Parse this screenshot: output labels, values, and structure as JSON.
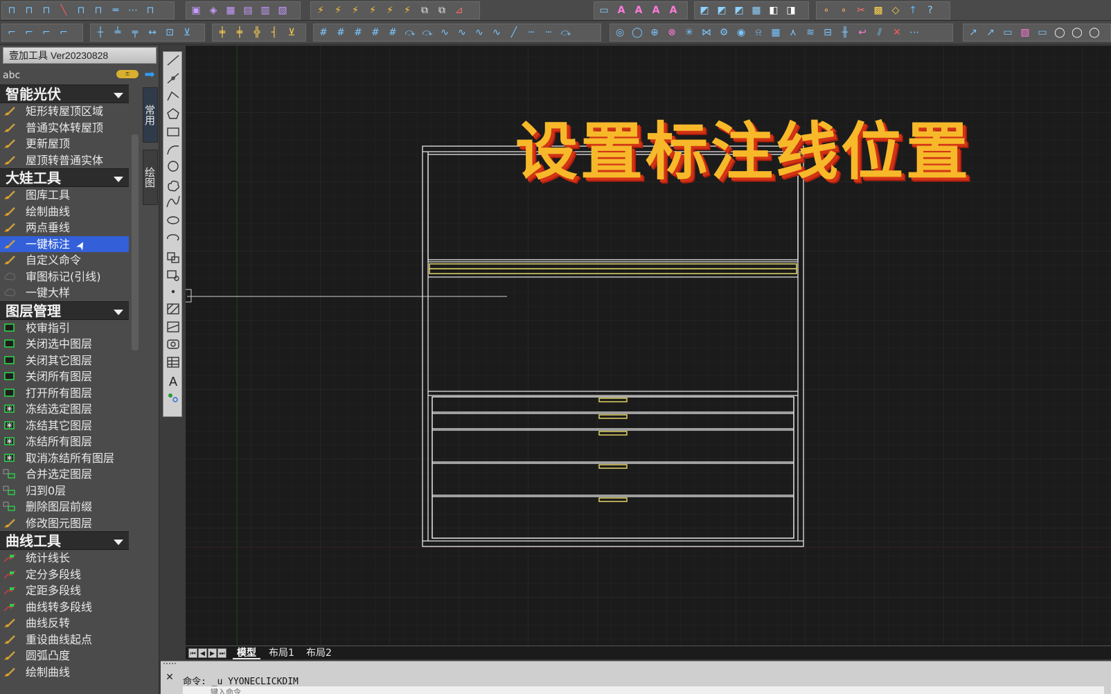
{
  "panel": {
    "title": "壹加工具 Ver20230828",
    "search_text": "abc",
    "side_tabs": {
      "common": "常用",
      "draw": "绘图"
    },
    "sections": [
      {
        "title": "智能光伏",
        "items": [
          {
            "label": "矩形转屋顶区域",
            "icon": "brush-icon"
          },
          {
            "label": "普通实体转屋顶",
            "icon": "brush-icon"
          },
          {
            "label": "更新屋顶",
            "icon": "brush-icon"
          },
          {
            "label": "屋顶转普通实体",
            "icon": "brush-icon"
          }
        ]
      },
      {
        "title": "大娃工具",
        "items": [
          {
            "label": "图库工具",
            "icon": "brush-icon"
          },
          {
            "label": "绘制曲线",
            "icon": "brush-icon"
          },
          {
            "label": "两点垂线",
            "icon": "brush-icon"
          },
          {
            "label": "一键标注",
            "icon": "brush-icon",
            "active": true
          },
          {
            "label": "自定义命令",
            "icon": "brush-icon"
          },
          {
            "label": "审图标记(引线)",
            "icon": "cloud-icon"
          },
          {
            "label": "一键大样",
            "icon": "cloud-icon"
          }
        ]
      },
      {
        "title": "图层管理",
        "items": [
          {
            "label": "校审指引",
            "icon": "layer-icon"
          },
          {
            "label": "关闭选中图层",
            "icon": "layer-icon"
          },
          {
            "label": "关闭其它图层",
            "icon": "layer-icon"
          },
          {
            "label": "关闭所有图层",
            "icon": "layer-icon"
          },
          {
            "label": "打开所有图层",
            "icon": "layer-icon"
          },
          {
            "label": "冻结选定图层",
            "icon": "freeze-icon"
          },
          {
            "label": "冻结其它图层",
            "icon": "freeze-icon"
          },
          {
            "label": "冻结所有图层",
            "icon": "freeze-icon"
          },
          {
            "label": "取消冻结所有图层",
            "icon": "freeze-icon"
          },
          {
            "label": "合并选定图层",
            "icon": "merge-icon"
          },
          {
            "label": "归到0层",
            "icon": "merge-icon"
          },
          {
            "label": "删除图层前缀",
            "icon": "merge-icon"
          },
          {
            "label": "修改图元图层",
            "icon": "brush-icon"
          }
        ]
      },
      {
        "title": "曲线工具",
        "items": [
          {
            "label": "统计线长",
            "icon": "polyline-icon"
          },
          {
            "label": "定分多段线",
            "icon": "polyline-icon"
          },
          {
            "label": "定距多段线",
            "icon": "polyline-icon"
          },
          {
            "label": "曲线转多段线",
            "icon": "polyline-icon"
          },
          {
            "label": "曲线反转",
            "icon": "brush-icon"
          },
          {
            "label": "重设曲线起点",
            "icon": "brush-icon"
          },
          {
            "label": "圆弧凸度",
            "icon": "brush-icon"
          },
          {
            "label": "绘制曲线",
            "icon": "brush-icon"
          }
        ]
      }
    ]
  },
  "canvas": {
    "overlay_title": "设置标注线位置",
    "colors": {
      "background": "#1b1b1b",
      "cabinet": "#e6e6e6",
      "handles": "#f0e26a",
      "title": "#f7b92a",
      "title_shadow": "#d23414"
    }
  },
  "layout_tabs": [
    "模型",
    "布局1",
    "布局2"
  ],
  "command": {
    "line1": "命令: _u YYONECLICKDIM",
    "line2": "键入命令"
  }
}
